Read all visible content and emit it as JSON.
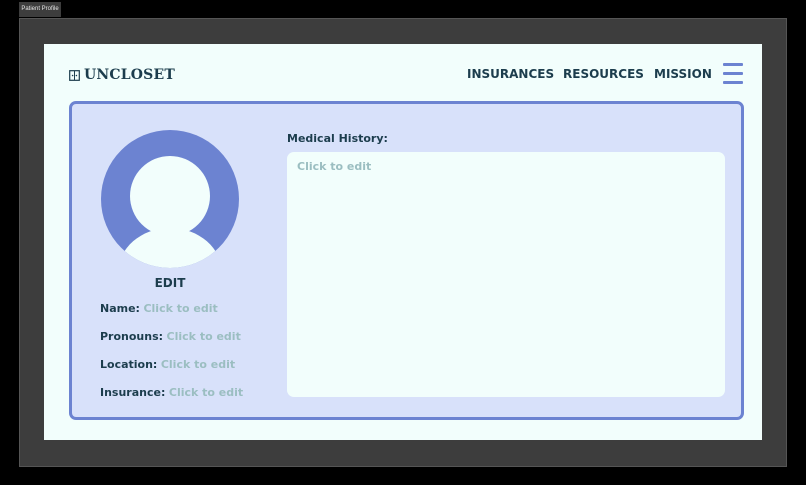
{
  "window": {
    "tab_title": "Patient Profile"
  },
  "header": {
    "logo_text": "UNCLOSET",
    "logo_icon": "closet-icon",
    "nav": {
      "insurances": "INSURANCES",
      "resources": "RESOURCES",
      "mission": "MISSION"
    },
    "menu_icon": "hamburger-menu-icon"
  },
  "profile": {
    "edit_label": "EDIT",
    "fields": {
      "name": {
        "label": "Name:",
        "value": "Click to edit"
      },
      "pronouns": {
        "label": "Pronouns:",
        "value": "Click to edit"
      },
      "location": {
        "label": "Location:",
        "value": "Click to edit"
      },
      "insurance": {
        "label": "Insurance:",
        "value": "Click to edit"
      }
    },
    "medical_history": {
      "label": "Medical History:",
      "placeholder": "Click to edit"
    }
  },
  "colors": {
    "accent": "#6c83d1",
    "text": "#1c3d4d",
    "placeholder": "#9bbec1",
    "page_bg": "#f2fefc",
    "card_bg": "#d8e1fa"
  }
}
